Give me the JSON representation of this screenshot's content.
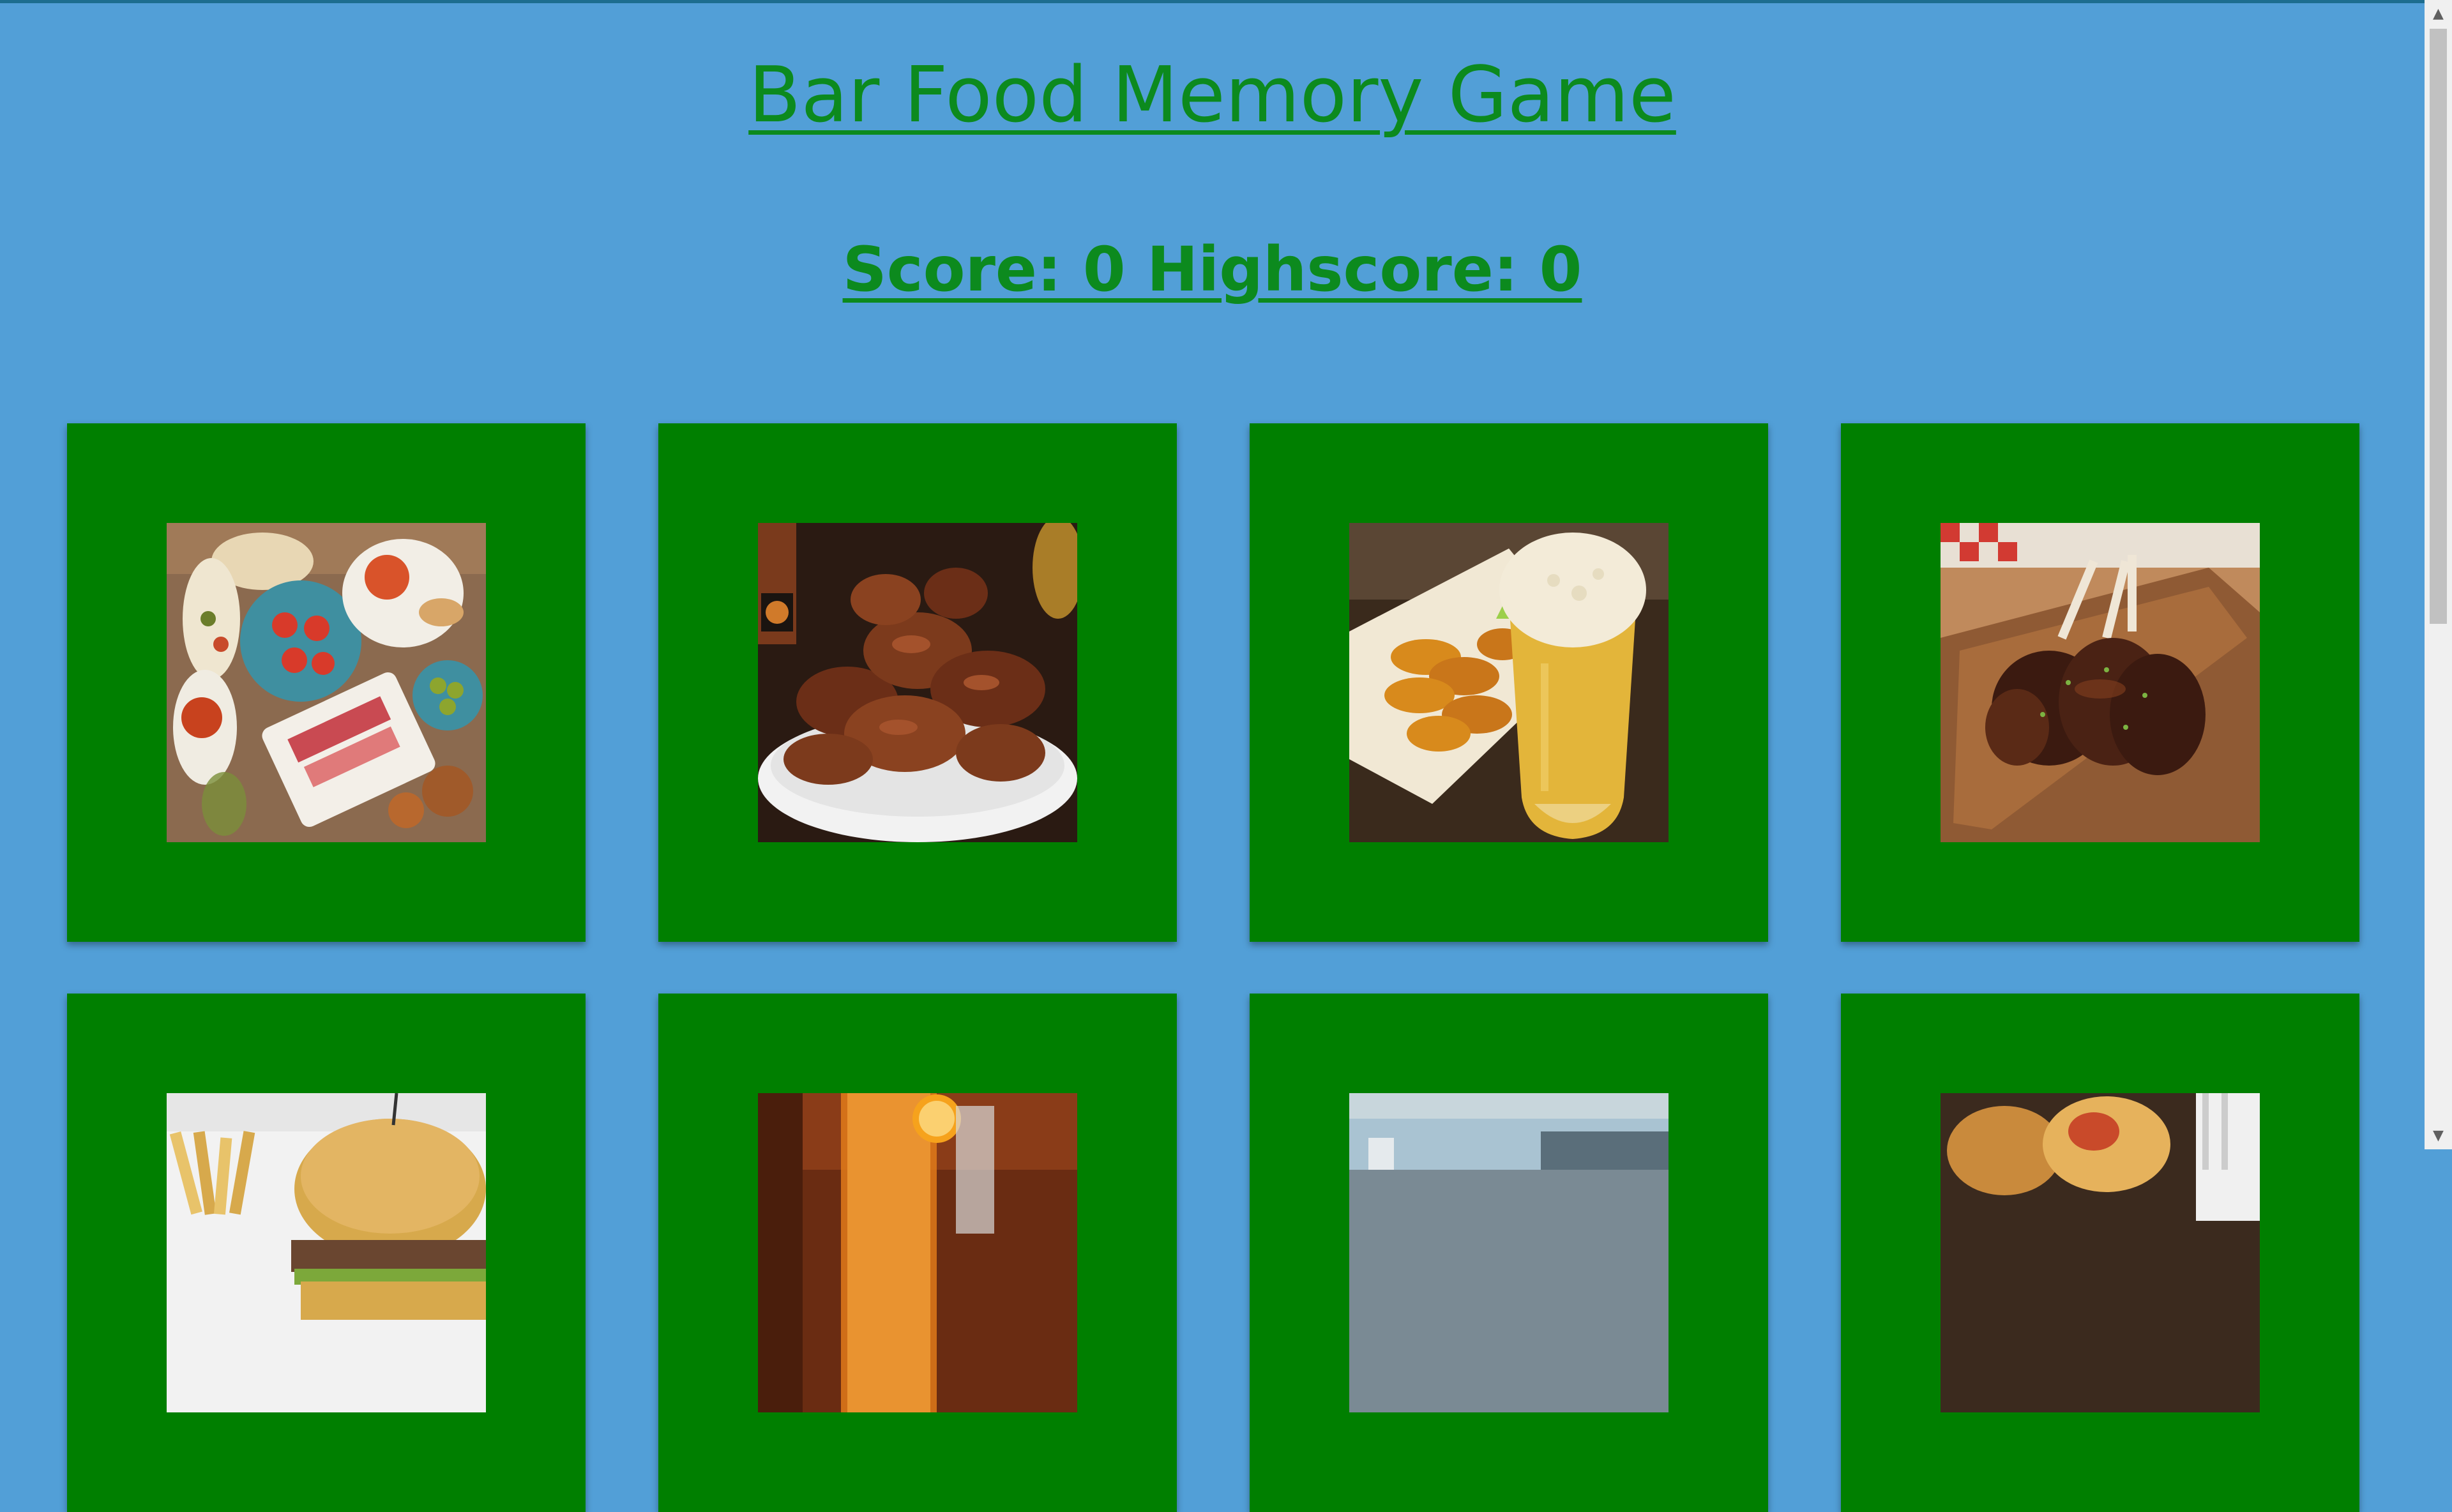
{
  "header": {
    "title": "Bar Food Memory Game",
    "score_text": "Score: 0 Highscore: 0"
  },
  "cards": [
    {
      "name": "tapas-platter",
      "colors": [
        "#8b6a4f",
        "#c84a2a",
        "#3f8fa0",
        "#e8d7b4"
      ]
    },
    {
      "name": "bbq-wings-bowl",
      "colors": [
        "#2a1a12",
        "#6b2e17",
        "#f2f2f2",
        "#a4522c"
      ]
    },
    {
      "name": "wings-and-beer",
      "colors": [
        "#3a2a1c",
        "#d88a1c",
        "#f1e8d4",
        "#e3b53a"
      ]
    },
    {
      "name": "glazed-ribs",
      "colors": [
        "#c08a5c",
        "#3b1a10",
        "#8f5a34",
        "#d23a32"
      ]
    },
    {
      "name": "burger-and-fries",
      "colors": [
        "#f2f2f2",
        "#d7a94c",
        "#e8c36a",
        "#6a4630"
      ]
    },
    {
      "name": "cocktail-drinks",
      "colors": [
        "#6a2c12",
        "#e07a1a",
        "#f4a23a",
        "#d9d9d9"
      ]
    },
    {
      "name": "outdoor-bar",
      "colors": [
        "#eef2f4",
        "#a9c3d2",
        "#5a6e7a",
        "#c8d6dc"
      ]
    },
    {
      "name": "fried-chicken",
      "colors": [
        "#3b2a1e",
        "#c98a3c",
        "#e6b25c",
        "#f0f0f0"
      ]
    }
  ],
  "scrollbar": {
    "up_arrow": "▲",
    "down_arrow": "▼"
  }
}
